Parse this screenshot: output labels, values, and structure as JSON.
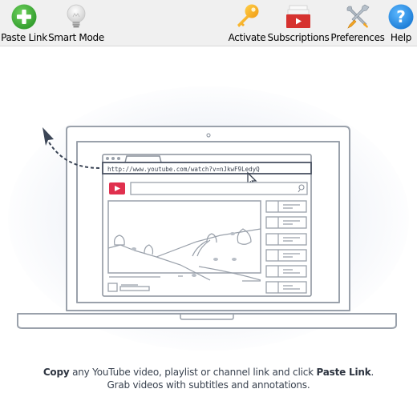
{
  "toolbar": {
    "buttons": [
      {
        "label": "Paste Link",
        "icon": "plus-circle-icon",
        "color": "#3fae3a"
      },
      {
        "label": "Smart Mode",
        "icon": "lightbulb-icon",
        "color": "#d0d0d0"
      },
      {
        "label": "Activate",
        "icon": "key-icon",
        "color": "#f5a623"
      },
      {
        "label": "Subscriptions",
        "icon": "subscriptions-icon",
        "color": "#d93a35"
      },
      {
        "label": "Preferences",
        "icon": "tools-icon",
        "color": "#8a99a8"
      },
      {
        "label": "Help",
        "icon": "help-icon",
        "color": "#2a8fe0"
      }
    ]
  },
  "illustration": {
    "url": "http://www.youtube.com/watch?v=nJkwF9LedyQ",
    "youtube_color": "#e0304e"
  },
  "caption": {
    "line1_bold_start": "Copy",
    "line1_middle": " any YouTube video, playlist or channel link and click ",
    "line1_bold_end": "Paste Link",
    "line1_end": ".",
    "line2": "Grab videos with subtitles and annotations."
  }
}
